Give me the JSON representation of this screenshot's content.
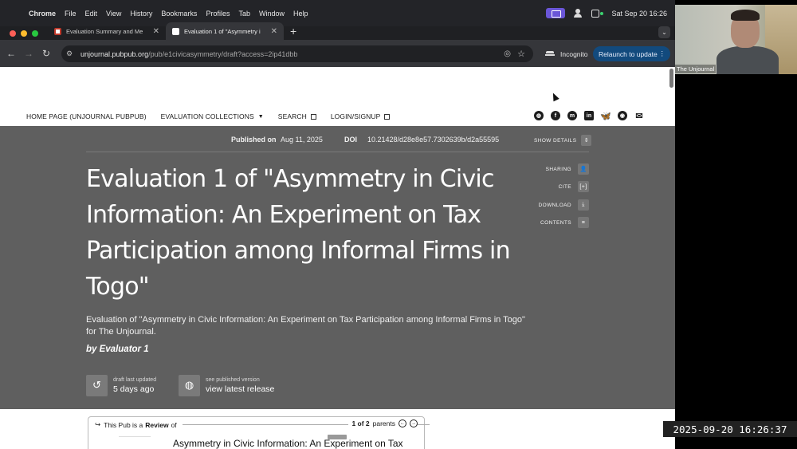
{
  "menubar": {
    "app": "Chrome",
    "items": [
      "File",
      "Edit",
      "View",
      "History",
      "Bookmarks",
      "Profiles",
      "Tab",
      "Window",
      "Help"
    ],
    "datetime": "Sat Sep 20  16:26"
  },
  "tabs": [
    {
      "label": "Evaluation Summary and Me",
      "favicon_color": "#c0392b"
    },
    {
      "label": "Evaluation 1 of \"Asymmetry i",
      "favicon_color": "#ffffff"
    }
  ],
  "toolbar": {
    "url_host": "unjournal.pubpub.org",
    "url_path": "/pub/e1civicasymmetry/draft?access=2ip41dbb",
    "incognito_label": "Incognito",
    "relaunch_label": "Relaunch to update"
  },
  "sitenav": {
    "home": "HOME PAGE (UNJOURNAL PUBPUB)",
    "collections": "EVALUATION COLLECTIONS",
    "search": "SEARCH",
    "login": "LOGIN/SIGNUP"
  },
  "header": {
    "published_label": "Published on",
    "published_date": "Aug 11, 2025",
    "doi_label": "DOI",
    "doi_value": "10.21428/d28e8e57.7302639b/d2a55595",
    "show_details": "SHOW DETAILS",
    "title": "Evaluation 1 of \"Asymmetry in Civic Information: An Experiment on Tax Participation among Informal Firms in Togo\"",
    "subtitle": "Evaluation of \"Asymmetry in Civic Information: An Experiment on Tax Participation among Informal Firms in Togo\" for The Unjournal.",
    "byline": "by Evaluator 1",
    "side": {
      "sharing": "SHARING",
      "cite": "CITE",
      "download": "DOWNLOAD",
      "contents": "CONTENTS"
    },
    "draft_small": "draft last updated",
    "draft_big": "5 days ago",
    "published_small": "see published version",
    "published_big": "view latest release"
  },
  "review": {
    "prefix": "This Pub is a",
    "type": "Review",
    "suffix": "of",
    "count": "1 of 2",
    "parents": "parents",
    "title": "Asymmetry in Civic Information: An Experiment on Tax"
  },
  "webcam": {
    "label": "The Unjournal"
  },
  "clock": "2025-09-20  16:26:37",
  "colors": {
    "hero_bg": "#5f5f5f",
    "relaunch_bg": "#124a7d",
    "menubar_accent": "#6a56d8"
  }
}
